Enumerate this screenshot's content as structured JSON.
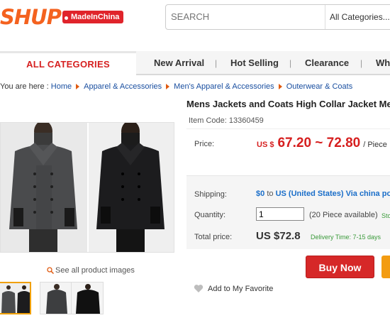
{
  "header": {
    "logo_text": "SHUP",
    "logo_tag": "MadeInChina",
    "search_placeholder": "SEARCH",
    "category_select": "All Categories..."
  },
  "nav": {
    "all_categories": "ALL CATEGORIES",
    "items": [
      "New Arrival",
      "Hot Selling",
      "Clearance",
      "Wh"
    ],
    "separator": "|"
  },
  "breadcrumb": {
    "prefix": "You are here :",
    "links": [
      "Home",
      "Apparel & Accessories",
      "Men's Apparel & Accessories",
      "Outerwear & Coats"
    ]
  },
  "product": {
    "title": "Mens Jackets and Coats High Collar Jacket Me",
    "item_code": "Item Code: 13360459",
    "see_all_images": "See all product images",
    "price_label": "Price:",
    "currency": "US $",
    "price_range": "67.20 ~ 72.80",
    "price_unit": "/ Piece",
    "shipping_label": "Shipping:",
    "shipping_cost": "$0",
    "shipping_to": "to",
    "shipping_dest": "US (United States) Via china po",
    "quantity_label": "Quantity:",
    "quantity_value": "1",
    "quantity_available": "(20 Piece available)",
    "stock_text": "Sto",
    "total_label": "Total price:",
    "total_value": "US $72.8",
    "delivery_time": "Delivery Time: 7-15 days",
    "buy_now": "Buy Now",
    "add_favorite": "Add to My Favorite"
  },
  "colors": {
    "brand_orange": "#f4621f",
    "price_red": "#d61f1f",
    "link_blue": "#1a4fa0",
    "buy_button": "#d62828",
    "cart_button": "#f39c12"
  }
}
